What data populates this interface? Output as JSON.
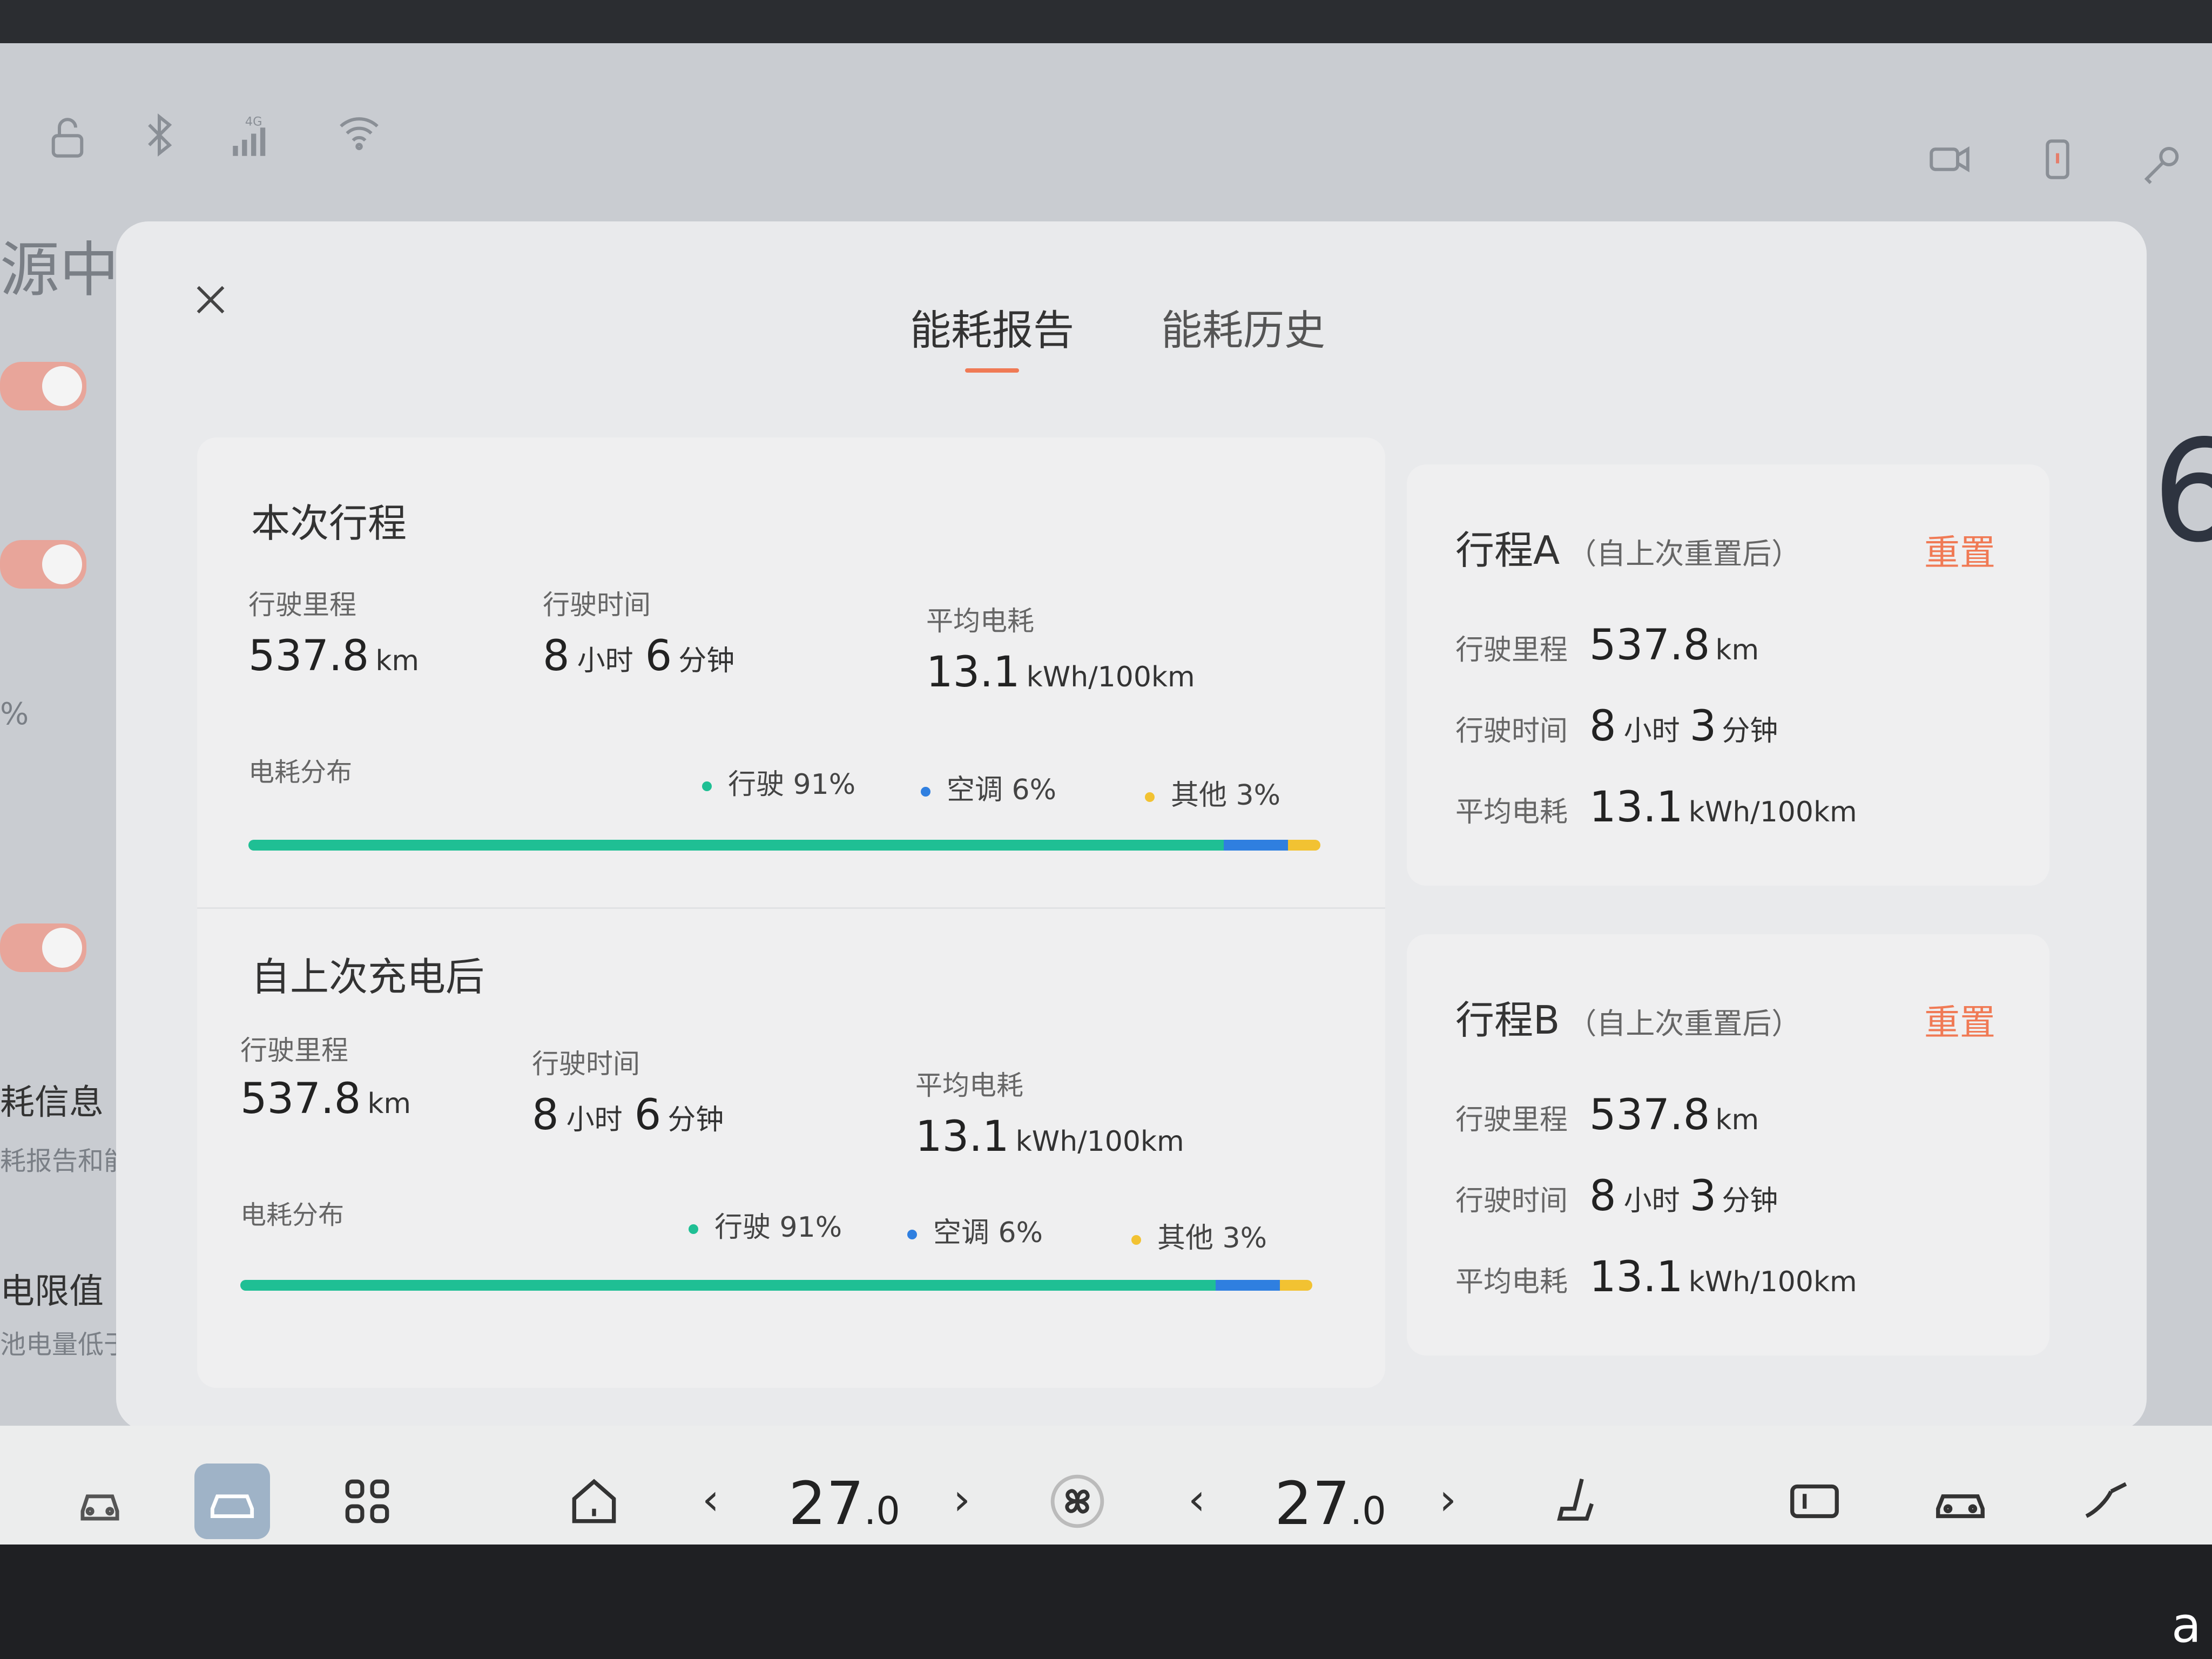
{
  "status_icons": [
    "lock-open-icon",
    "bluetooth-icon",
    "cellular-4g-icon",
    "wifi-icon",
    "dashcam-icon",
    "phone-icon",
    "key-icon"
  ],
  "signal_label": "4G",
  "background": {
    "title_fragment": "源中",
    "pct_fragment": "%",
    "info_title": "耗信息",
    "info_sub": "耗报告和能",
    "limit_title": "电限值",
    "limit_sub": "池电量低于设定值时停止供电",
    "big_digit": "6"
  },
  "modal": {
    "tabs": [
      {
        "label": "能耗报告",
        "active": true
      },
      {
        "label": "能耗历史",
        "active": false
      }
    ],
    "sections": [
      {
        "title": "本次行程",
        "distance_label": "行驶里程",
        "distance": "537.8",
        "distance_unit": "km",
        "time_label": "行驶时间",
        "hours": "8",
        "hours_unit": "小时",
        "minutes": "6",
        "minutes_unit": "分钟",
        "consumption_label": "平均电耗",
        "consumption": "13.1",
        "consumption_unit": "kWh/100km",
        "dist_label": "电耗分布",
        "legend": [
          "行驶 91%",
          "空调 6%",
          "其他 3%"
        ]
      },
      {
        "title": "自上次充电后",
        "distance_label": "行驶里程",
        "distance": "537.8",
        "distance_unit": "km",
        "time_label": "行驶时间",
        "hours": "8",
        "hours_unit": "小时",
        "minutes": "6",
        "minutes_unit": "分钟",
        "consumption_label": "平均电耗",
        "consumption": "13.1",
        "consumption_unit": "kWh/100km",
        "dist_label": "电耗分布",
        "legend": [
          "行驶 91%",
          "空调 6%",
          "其他 3%"
        ]
      }
    ],
    "distribution": {
      "driving": 0.91,
      "ac": 0.06,
      "other": 0.03
    },
    "colors": {
      "driving": "#1fbf94",
      "ac": "#2f7fe0",
      "other": "#f2c232",
      "accent": "#f07a55"
    },
    "trips": [
      {
        "title": "行程A",
        "subtitle": "（自上次重置后）",
        "reset_label": "重置",
        "distance_label": "行驶里程",
        "distance": "537.8",
        "distance_unit": "km",
        "time_label": "行驶时间",
        "hours": "8",
        "hours_unit": "小时",
        "minutes": "3",
        "minutes_unit": "分钟",
        "consumption_label": "平均电耗",
        "consumption": "13.1",
        "consumption_unit": "kWh/100km"
      },
      {
        "title": "行程B",
        "subtitle": "（自上次重置后）",
        "reset_label": "重置",
        "distance_label": "行驶里程",
        "distance": "537.8",
        "distance_unit": "km",
        "time_label": "行驶时间",
        "hours": "8",
        "hours_unit": "小时",
        "minutes": "3",
        "minutes_unit": "分钟",
        "consumption_label": "平均电耗",
        "consumption": "13.1",
        "consumption_unit": "kWh/100km"
      }
    ]
  },
  "dock": {
    "left_temp": "27",
    "left_temp_dec": ".0",
    "right_temp": "27",
    "right_temp_dec": ".0",
    "arrow_left": "‹",
    "arrow_right": "›",
    "icons": [
      "vehicle-front-icon",
      "car-app-icon",
      "apps-grid-icon",
      "home-icon",
      "fan-icon",
      "seat-icon",
      "display-icon",
      "car-side-icon",
      "wiper-icon"
    ]
  },
  "corner_mark": "a"
}
